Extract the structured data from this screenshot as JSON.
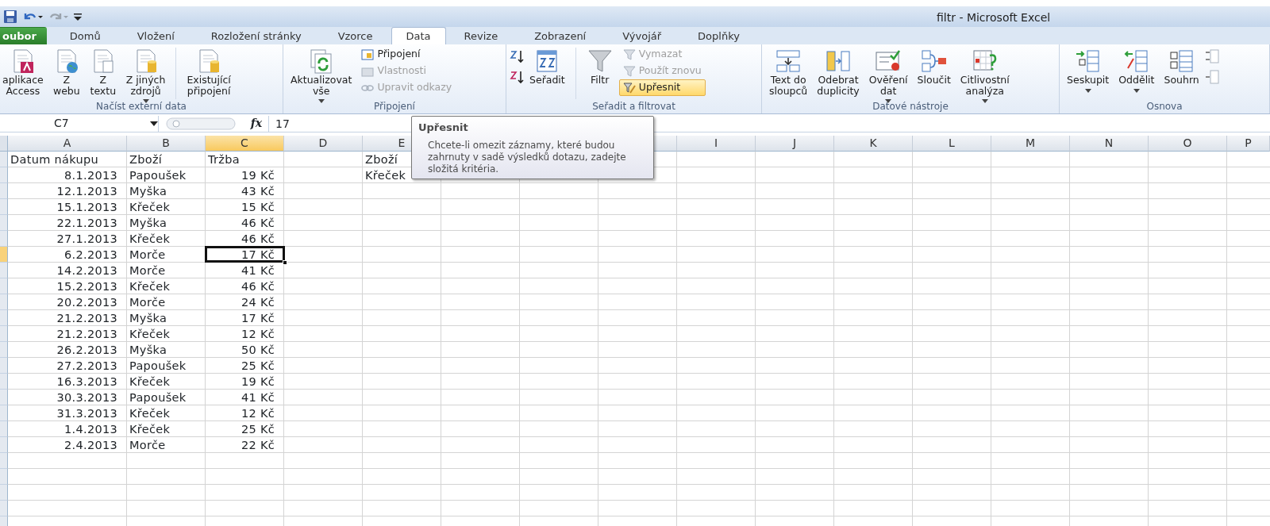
{
  "window": {
    "title": "filtr  -  Microsoft Excel"
  },
  "tabs": [
    {
      "label": "oubor",
      "kind": "file",
      "selected": false
    },
    {
      "label": "Domů",
      "kind": "tab",
      "selected": false
    },
    {
      "label": "Vložení",
      "kind": "tab",
      "selected": false
    },
    {
      "label": "Rozložení stránky",
      "kind": "tab",
      "selected": false
    },
    {
      "label": "Vzorce",
      "kind": "tab",
      "selected": false
    },
    {
      "label": "Data",
      "kind": "tab",
      "selected": true
    },
    {
      "label": "Revize",
      "kind": "tab",
      "selected": false
    },
    {
      "label": "Zobrazení",
      "kind": "tab",
      "selected": false
    },
    {
      "label": "Vývojář",
      "kind": "tab",
      "selected": false
    },
    {
      "label": "Doplňky",
      "kind": "tab",
      "selected": false
    }
  ],
  "ribbon_groups": [
    {
      "label": "Načíst externí data",
      "items": [
        {
          "kind": "large",
          "label": "aplikace\nAccess",
          "dropdown": false
        },
        {
          "kind": "large",
          "label": "Z\nwebu",
          "dropdown": false
        },
        {
          "kind": "large",
          "label": "Z\ntextu",
          "dropdown": false
        },
        {
          "kind": "large",
          "label": "Z jiných\nzdrojů",
          "dropdown": true
        },
        {
          "kind": "separator"
        },
        {
          "kind": "large",
          "label": "Existující\npřipojení",
          "dropdown": false
        }
      ]
    },
    {
      "label": "Připojení",
      "items": [
        {
          "kind": "large",
          "label": "Aktualizovat\nvše",
          "dropdown": true
        },
        {
          "kind": "stack",
          "buttons": [
            {
              "label": "Připojení",
              "disabled": false,
              "highlighted": false
            },
            {
              "label": "Vlastnosti",
              "disabled": true,
              "highlighted": false
            },
            {
              "label": "Upravit odkazy",
              "disabled": true,
              "highlighted": false
            }
          ]
        }
      ]
    },
    {
      "label": "Seřadit a filtrovat",
      "items": [
        {
          "kind": "iconstack"
        },
        {
          "kind": "large",
          "label": "Seřadit",
          "dropdown": false
        },
        {
          "kind": "separator"
        },
        {
          "kind": "large",
          "label": "Filtr",
          "dropdown": false
        },
        {
          "kind": "stack",
          "buttons": [
            {
              "label": "Vymazat",
              "disabled": true,
              "highlighted": false
            },
            {
              "label": "Použít znovu",
              "disabled": true,
              "highlighted": false
            },
            {
              "label": "Upřesnit",
              "disabled": false,
              "highlighted": true
            }
          ]
        }
      ]
    },
    {
      "label": "Datové nástroje",
      "items": [
        {
          "kind": "large",
          "label": "Text do\nsloupců",
          "dropdown": false
        },
        {
          "kind": "large",
          "label": "Odebrat\nduplicity",
          "dropdown": false
        },
        {
          "kind": "large",
          "label": "Ověření\ndat",
          "dropdown": true
        },
        {
          "kind": "large",
          "label": "Sloučit",
          "dropdown": false
        },
        {
          "kind": "large",
          "label": "Citlivostní\nanalýza",
          "dropdown": true
        }
      ]
    },
    {
      "label": "Osnova",
      "items": [
        {
          "kind": "large",
          "label": "Seskupit",
          "dropdown": true
        },
        {
          "kind": "large",
          "label": "Oddělit",
          "dropdown": true
        },
        {
          "kind": "large",
          "label": "Souhrn",
          "dropdown": false
        },
        {
          "kind": "iconstack"
        }
      ]
    }
  ],
  "formula_bar": {
    "name_box": "C7",
    "function_label": "fx",
    "value": "17"
  },
  "tooltip": {
    "title": "Upřesnit",
    "text": "Chcete-li omezit záznamy, které budou zahrnuty v sadě výsledků dotazu, zadejte složitá kritéria."
  },
  "columns": [
    {
      "label": "A",
      "selected": false
    },
    {
      "label": "B",
      "selected": false
    },
    {
      "label": "C",
      "selected": true
    },
    {
      "label": "D",
      "selected": false
    },
    {
      "label": "E",
      "selected": false
    },
    {
      "covered": true
    },
    {
      "label": "I",
      "selected": false
    },
    {
      "label": "J",
      "selected": false
    },
    {
      "label": "K",
      "selected": false
    },
    {
      "label": "L",
      "selected": false
    },
    {
      "label": "M",
      "selected": false
    },
    {
      "label": "N",
      "selected": false
    },
    {
      "label": "O",
      "selected": false
    },
    {
      "label": "P",
      "selected": false
    }
  ],
  "rows": [
    {
      "selected": false,
      "cells": {
        "A": {
          "text": "Datum nákupu",
          "kind": "text"
        },
        "B": {
          "text": "Zboží",
          "kind": "text"
        },
        "C": {
          "text": "Tržba",
          "kind": "text"
        },
        "E": {
          "text": "Zboží",
          "kind": "text"
        }
      }
    },
    {
      "selected": false,
      "cells": {
        "A": {
          "text": "8.1.2013",
          "kind": "number"
        },
        "B": {
          "text": "Papoušek",
          "kind": "text"
        },
        "C": {
          "text": "19 Kč",
          "kind": "number"
        },
        "E": {
          "text": "Křeček",
          "kind": "text"
        }
      }
    },
    {
      "selected": false,
      "cells": {
        "A": {
          "text": "12.1.2013",
          "kind": "number"
        },
        "B": {
          "text": "Myška",
          "kind": "text"
        },
        "C": {
          "text": "43 Kč",
          "kind": "number"
        }
      }
    },
    {
      "selected": false,
      "cells": {
        "A": {
          "text": "15.1.2013",
          "kind": "number"
        },
        "B": {
          "text": "Křeček",
          "kind": "text"
        },
        "C": {
          "text": "15 Kč",
          "kind": "number"
        }
      }
    },
    {
      "selected": false,
      "cells": {
        "A": {
          "text": "22.1.2013",
          "kind": "number"
        },
        "B": {
          "text": "Myška",
          "kind": "text"
        },
        "C": {
          "text": "46 Kč",
          "kind": "number"
        }
      }
    },
    {
      "selected": false,
      "cells": {
        "A": {
          "text": "27.1.2013",
          "kind": "number"
        },
        "B": {
          "text": "Křeček",
          "kind": "text"
        },
        "C": {
          "text": "46 Kč",
          "kind": "number"
        }
      }
    },
    {
      "selected": true,
      "cells": {
        "A": {
          "text": "6.2.2013",
          "kind": "number"
        },
        "B": {
          "text": "Morče",
          "kind": "text"
        },
        "C": {
          "text": "17 Kč",
          "kind": "number",
          "active": true
        }
      }
    },
    {
      "selected": false,
      "cells": {
        "A": {
          "text": "14.2.2013",
          "kind": "number"
        },
        "B": {
          "text": "Morče",
          "kind": "text"
        },
        "C": {
          "text": "41 Kč",
          "kind": "number"
        }
      }
    },
    {
      "selected": false,
      "cells": {
        "A": {
          "text": "15.2.2013",
          "kind": "number"
        },
        "B": {
          "text": "Křeček",
          "kind": "text"
        },
        "C": {
          "text": "46 Kč",
          "kind": "number"
        }
      }
    },
    {
      "selected": false,
      "cells": {
        "A": {
          "text": "20.2.2013",
          "kind": "number"
        },
        "B": {
          "text": "Morče",
          "kind": "text"
        },
        "C": {
          "text": "24 Kč",
          "kind": "number"
        }
      }
    },
    {
      "selected": false,
      "cells": {
        "A": {
          "text": "21.2.2013",
          "kind": "number"
        },
        "B": {
          "text": "Myška",
          "kind": "text"
        },
        "C": {
          "text": "17 Kč",
          "kind": "number"
        }
      }
    },
    {
      "selected": false,
      "cells": {
        "A": {
          "text": "21.2.2013",
          "kind": "number"
        },
        "B": {
          "text": "Křeček",
          "kind": "text"
        },
        "C": {
          "text": "12 Kč",
          "kind": "number"
        }
      }
    },
    {
      "selected": false,
      "cells": {
        "A": {
          "text": "26.2.2013",
          "kind": "number"
        },
        "B": {
          "text": "Myška",
          "kind": "text"
        },
        "C": {
          "text": "50 Kč",
          "kind": "number"
        }
      }
    },
    {
      "selected": false,
      "cells": {
        "A": {
          "text": "27.2.2013",
          "kind": "number"
        },
        "B": {
          "text": "Papoušek",
          "kind": "text"
        },
        "C": {
          "text": "25 Kč",
          "kind": "number"
        }
      }
    },
    {
      "selected": false,
      "cells": {
        "A": {
          "text": "16.3.2013",
          "kind": "number"
        },
        "B": {
          "text": "Křeček",
          "kind": "text"
        },
        "C": {
          "text": "19 Kč",
          "kind": "number"
        }
      }
    },
    {
      "selected": false,
      "cells": {
        "A": {
          "text": "30.3.2013",
          "kind": "number"
        },
        "B": {
          "text": "Papoušek",
          "kind": "text"
        },
        "C": {
          "text": "41 Kč",
          "kind": "number"
        }
      }
    },
    {
      "selected": false,
      "cells": {
        "A": {
          "text": "31.3.2013",
          "kind": "number"
        },
        "B": {
          "text": "Křeček",
          "kind": "text"
        },
        "C": {
          "text": "12 Kč",
          "kind": "number"
        }
      }
    },
    {
      "selected": false,
      "cells": {
        "A": {
          "text": "1.4.2013",
          "kind": "number"
        },
        "B": {
          "text": "Křeček",
          "kind": "text"
        },
        "C": {
          "text": "25 Kč",
          "kind": "number"
        }
      }
    },
    {
      "selected": false,
      "cells": {
        "A": {
          "text": "2.4.2013",
          "kind": "number"
        },
        "B": {
          "text": "Morče",
          "kind": "text"
        },
        "C": {
          "text": "22 Kč",
          "kind": "number"
        }
      }
    }
  ]
}
